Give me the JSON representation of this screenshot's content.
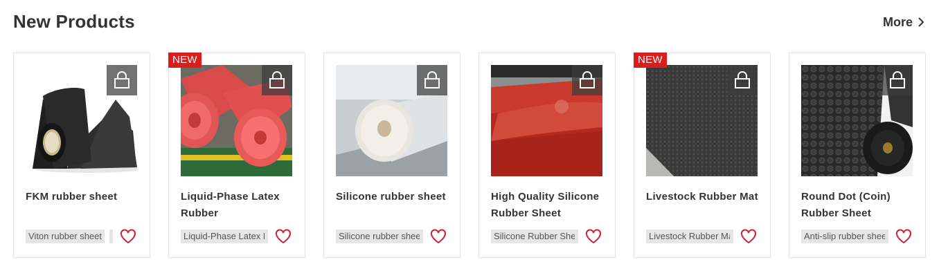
{
  "section": {
    "title": "New Products",
    "more_label": "More"
  },
  "colors": {
    "badge": "#d91e1e",
    "heart": "#d0202a",
    "tag_bg": "#e6e6e6"
  },
  "products": [
    {
      "name": "FKM rubber sheet",
      "tag": "Viton rubber sheet",
      "badge": "",
      "image": "black-rubber-roll"
    },
    {
      "name": "Liquid-Phase Latex Rubber",
      "tag": "Liquid-Phase Latex R",
      "badge": "NEW",
      "image": "red-latex-rolls"
    },
    {
      "name": "Silicone rubber sheet",
      "tag": "Silicone rubber shee",
      "badge": "",
      "image": "white-silicone-roll"
    },
    {
      "name": "High Quality Silicone Rubber Sheet",
      "tag": "Silicone Rubber She",
      "badge": "",
      "image": "red-silicone-sheet"
    },
    {
      "name": "Livestock Rubber Mat",
      "tag": "Livestock Rubber Ma",
      "badge": "NEW",
      "image": "grey-rubber-mat"
    },
    {
      "name": "Round Dot (Coin) Rubber Sheet",
      "tag": "Anti-slip rubber shee",
      "badge": "",
      "image": "coin-rubber-rolls"
    }
  ]
}
